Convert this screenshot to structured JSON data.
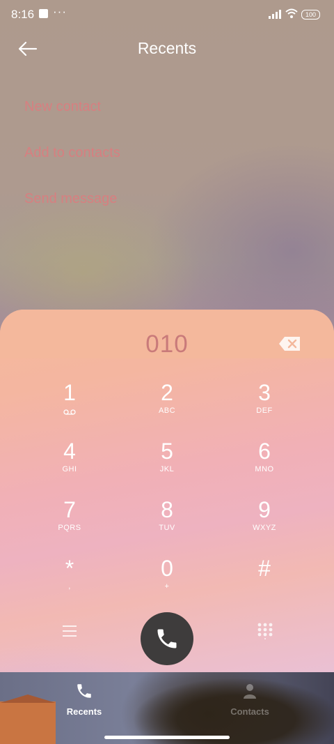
{
  "status_bar": {
    "time": "8:16",
    "more": "···",
    "battery": "100"
  },
  "header": {
    "title": "Recents",
    "back_icon": "arrow-left-icon"
  },
  "options": [
    {
      "label": "New contact"
    },
    {
      "label": "Add to contacts"
    },
    {
      "label": "Send message"
    }
  ],
  "dialer": {
    "number": "010",
    "backspace_icon": "backspace-icon",
    "keys": [
      {
        "digit": "1",
        "letters": "voicemail-icon"
      },
      {
        "digit": "2",
        "letters": "ABC"
      },
      {
        "digit": "3",
        "letters": "DEF"
      },
      {
        "digit": "4",
        "letters": "GHI"
      },
      {
        "digit": "5",
        "letters": "JKL"
      },
      {
        "digit": "6",
        "letters": "MNO"
      },
      {
        "digit": "7",
        "letters": "PQRS"
      },
      {
        "digit": "8",
        "letters": "TUV"
      },
      {
        "digit": "9",
        "letters": "WXYZ"
      },
      {
        "digit": "*",
        "letters": ","
      },
      {
        "digit": "0",
        "letters": "+"
      },
      {
        "digit": "#",
        "letters": ""
      }
    ],
    "menu_icon": "menu-icon",
    "call_icon": "phone-icon",
    "keypad_icon": "keypad-grid-icon"
  },
  "bottom_nav": {
    "recents_label": "Recents",
    "contacts_label": "Contacts"
  },
  "colors": {
    "accent_text": "#d77f80",
    "call_button": "#3e3c3c"
  }
}
